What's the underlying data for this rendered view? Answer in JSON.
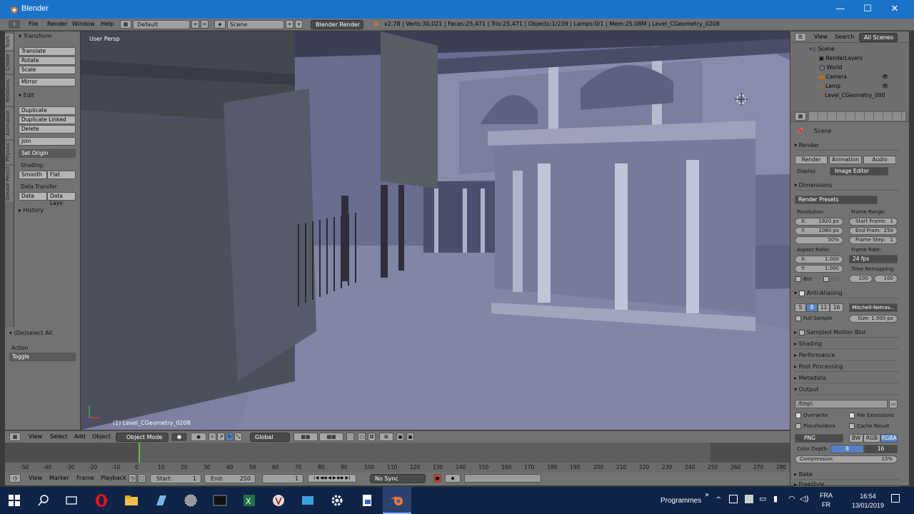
{
  "window": {
    "title": "Blender",
    "controls": [
      "—",
      "☐",
      "✕"
    ]
  },
  "infobar": {
    "menus": [
      "File",
      "Render",
      "Window",
      "Help"
    ],
    "layout": "Default",
    "scene": "Scene",
    "engine": "Blender Render",
    "stats": "v2.78 | Verts:30,021 | Faces:25,471 | Tris:25,471 | Objects:1/239 | Lamps:0/1 | Mem:25.08M | Level_CGeometry_0208"
  },
  "toolshelf": {
    "tabs": [
      "Tools",
      "Create",
      "Relations",
      "Animation",
      "Physics",
      "Grease Pencil"
    ],
    "transform_header": "Transform",
    "transform_buttons": [
      "Translate",
      "Rotate",
      "Scale"
    ],
    "mirror": "Mirror",
    "edit_header": "Edit",
    "edit_buttons": [
      "Duplicate",
      "Duplicate Linked",
      "Delete"
    ],
    "join": "Join",
    "set_origin": "Set Origin",
    "shading_label": "Shading:",
    "smooth": "Smooth",
    "flat": "Flat",
    "data_transfer_label": "Data Transfer:",
    "data": "Data",
    "data_layo": "Data Layo",
    "history": "History",
    "deselect_header": "(De)select All",
    "action_label": "Action",
    "action_value": "Toggle"
  },
  "viewport": {
    "view_name": "User Persp",
    "object_label": "(1) Level_CGeometry_0208"
  },
  "viewport_header": {
    "menus": [
      "View",
      "Select",
      "Add",
      "Object"
    ],
    "mode": "Object Mode",
    "orientation": "Global"
  },
  "timeline": {
    "ticks": [
      "-50",
      "-40",
      "-30",
      "-20",
      "-10",
      "0",
      "10",
      "20",
      "30",
      "40",
      "50",
      "60",
      "70",
      "80",
      "90",
      "100",
      "110",
      "120",
      "130",
      "140",
      "150",
      "160",
      "170",
      "180",
      "190",
      "200",
      "210",
      "220",
      "230",
      "240",
      "250",
      "260",
      "270",
      "280"
    ],
    "current_frame": 0,
    "menus": [
      "View",
      "Marker",
      "Frame",
      "Playback"
    ],
    "start_label": "Start:",
    "start_value": "1",
    "end_label": "End:",
    "end_value": "250",
    "frame_value": "1",
    "sync": "No Sync"
  },
  "outliner": {
    "menus": [
      "View",
      "Search"
    ],
    "filter": "All Scenes",
    "items": [
      "Scene",
      "RenderLayers",
      "World",
      "Camera",
      "Lamp",
      "Level_CGeometry_000"
    ]
  },
  "properties": {
    "context": "Scene",
    "render_header": "Render",
    "render_btn": "Render",
    "animation_btn": "Animation",
    "audio_btn": "Audio",
    "display_label": "Display:",
    "display_value": "Image Editor",
    "dimensions_header": "Dimensions",
    "render_presets": "Render Presets",
    "resolution_label": "Resolution:",
    "res_x": "X:",
    "res_x_val": "1920 px",
    "res_y": "Y:",
    "res_y_val": "1080 px",
    "res_pct": "50%",
    "frame_range_label": "Frame Range:",
    "start_frame": "Start Frame:",
    "start_frame_val": "1",
    "end_frame": "End Fram:",
    "end_frame_val": "250",
    "frame_step": "Frame Step:",
    "frame_step_val": "1",
    "aspect_label": "Aspect Ratio:",
    "asp_x": "X:",
    "asp_x_val": "1.000",
    "asp_y": "Y:",
    "asp_y_val": "1.000",
    "frame_rate_label": "Frame Rate:",
    "frame_rate": "24 fps",
    "time_remap_label": "Time Remapping:",
    "remap_a": "100",
    "remap_b": "100",
    "bor": "Bor",
    "cro": "Cro",
    "aa_header": "Anti-Aliasing",
    "aa_samples": [
      "5",
      "8",
      "11",
      "16"
    ],
    "aa_filter": "Mitchell-Netrav...",
    "full_sample": "Full Sample",
    "aa_size": "Size: 1.000 px",
    "motion_blur": "Sampled Motion Blur",
    "shading": "Shading",
    "performance": "Performance",
    "post_processing": "Post Processing",
    "metadata": "Metadata",
    "output_header": "Output",
    "output_path": "/tmp\\",
    "overwrite": "Overwrite",
    "file_extensions": "File Extensions",
    "placeholders": "Placeholders",
    "cache_result": "Cache Result",
    "format": "PNG",
    "bw": "BW",
    "rgb": "RGB",
    "rgba": "RGBA",
    "color_depth_label": "Color Depth:",
    "depth_8": "8",
    "depth_16": "16",
    "compression": "Compression:",
    "compression_val": "15%",
    "bake": "Bake",
    "freestyle": "Freestyle"
  },
  "taskbar": {
    "programmes": "Programmes",
    "lang_a": "FRA",
    "lang_b": "FR",
    "time": "16:54",
    "date": "13/01/2019"
  }
}
